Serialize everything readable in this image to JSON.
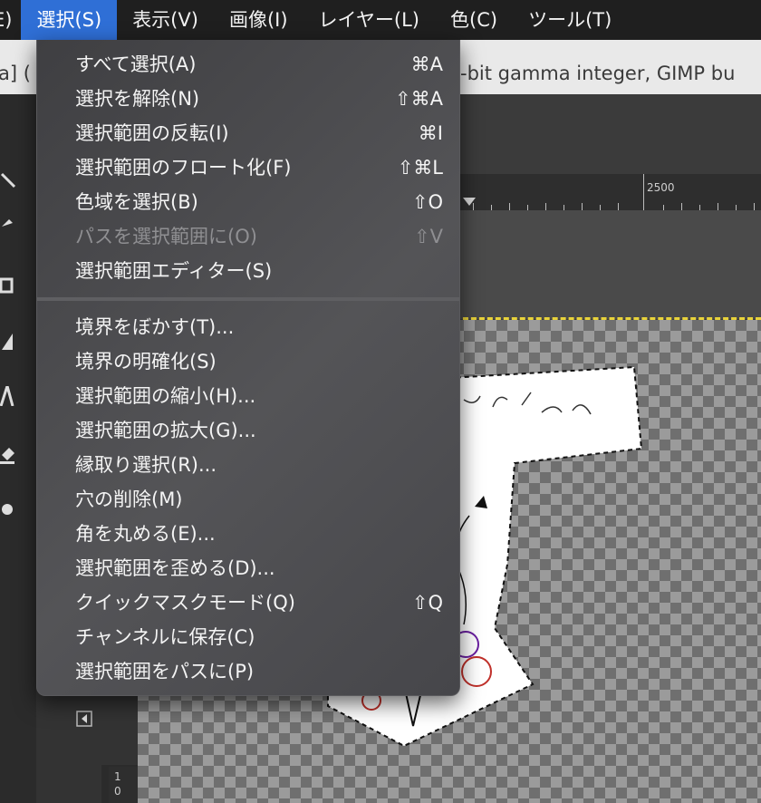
{
  "menubar": {
    "items": [
      {
        "label": "E)"
      },
      {
        "label": "選択(S)",
        "active": true
      },
      {
        "label": "表示(V)"
      },
      {
        "label": "画像(I)"
      },
      {
        "label": "レイヤー(L)"
      },
      {
        "label": "色(C)"
      },
      {
        "label": "ツール(T)"
      }
    ]
  },
  "titlebar": {
    "left_fragment": "a] (",
    "right_fragment": "-bit gamma integer, GIMP bu"
  },
  "ruler": {
    "label": "2500"
  },
  "vruler": {
    "labels": [
      "1",
      "0"
    ]
  },
  "colors": {
    "menubar_active": "#2f6fd6",
    "selection_marching_ants": "#e8d23a"
  },
  "dropdown": {
    "items": [
      {
        "label": "すべて選択(A)",
        "shortcut": "⌘A"
      },
      {
        "label": "選択を解除(N)",
        "shortcut": "⇧⌘A"
      },
      {
        "label": "選択範囲の反転(I)",
        "shortcut": "⌘I"
      },
      {
        "label": "選択範囲のフロート化(F)",
        "shortcut": "⇧⌘L"
      },
      {
        "label": "色域を選択(B)",
        "shortcut": "⇧O"
      },
      {
        "label": "パスを選択範囲に(O)",
        "shortcut": "⇧V",
        "disabled": true
      },
      {
        "label": "選択範囲エディター(S)",
        "shortcut": ""
      },
      {
        "label": "境界をぼかす(T)...",
        "shortcut": ""
      },
      {
        "label": "境界の明確化(S)",
        "shortcut": ""
      },
      {
        "label": "選択範囲の縮小(H)...",
        "shortcut": ""
      },
      {
        "label": "選択範囲の拡大(G)...",
        "shortcut": ""
      },
      {
        "label": "縁取り選択(R)...",
        "shortcut": ""
      },
      {
        "label": "穴の削除(M)",
        "shortcut": ""
      },
      {
        "label": "角を丸める(E)...",
        "shortcut": ""
      },
      {
        "label": "選択範囲を歪める(D)...",
        "shortcut": ""
      },
      {
        "label": "クイックマスクモード(Q)",
        "shortcut": "⇧Q"
      },
      {
        "label": "チャンネルに保存(C)",
        "shortcut": ""
      },
      {
        "label": "選択範囲をパスに(P)",
        "shortcut": ""
      }
    ]
  }
}
